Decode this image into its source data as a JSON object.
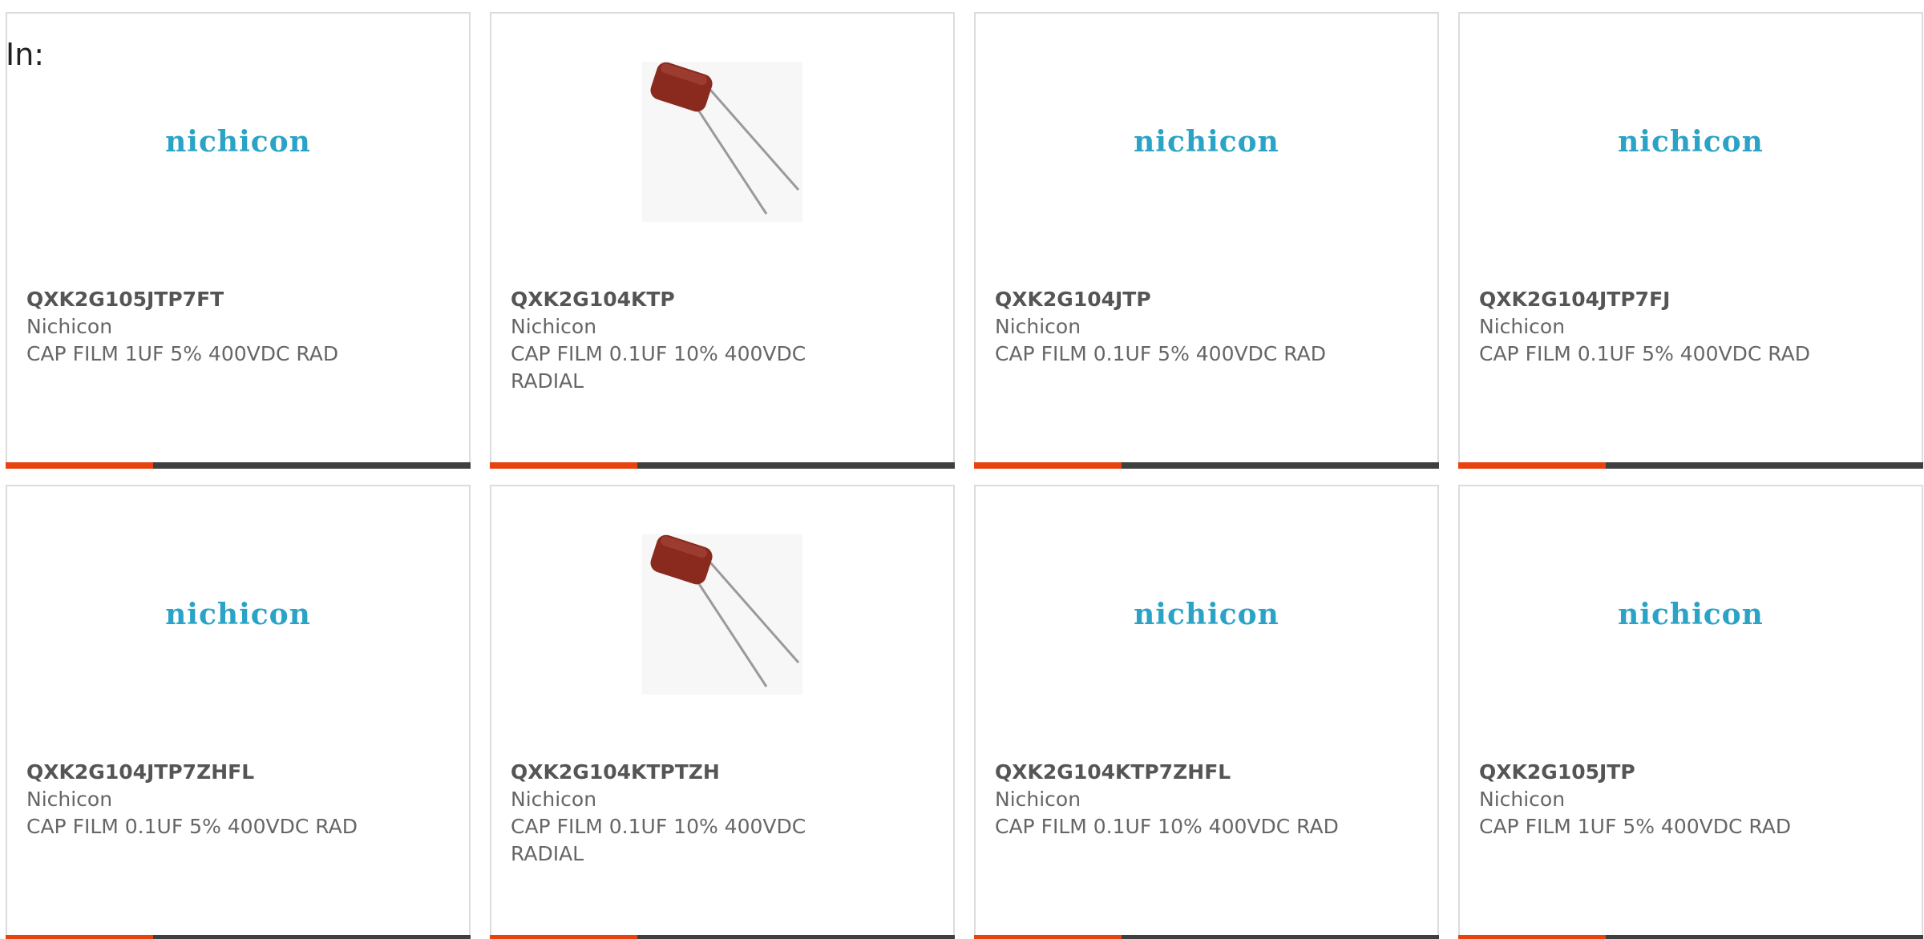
{
  "filter": {
    "in_label": "In:"
  },
  "products": [
    {
      "part": "QXK2G105JTP7FT",
      "maker": "Nichicon",
      "desc": "CAP FILM 1UF 5% 400VDC RAD",
      "image": "nichicon-logo",
      "logo_text": "nichicon"
    },
    {
      "part": "QXK2G104KTP",
      "maker": "Nichicon",
      "desc": "CAP FILM 0.1UF 10% 400VDC RADIAL",
      "image": "capacitor-photo",
      "logo_text": ""
    },
    {
      "part": "QXK2G104JTP",
      "maker": "Nichicon",
      "desc": "CAP FILM 0.1UF 5% 400VDC RAD",
      "image": "nichicon-logo",
      "logo_text": "nichicon"
    },
    {
      "part": "QXK2G104JTP7FJ",
      "maker": "Nichicon",
      "desc": "CAP FILM 0.1UF 5% 400VDC RAD",
      "image": "nichicon-logo",
      "logo_text": "nichicon"
    },
    {
      "part": "QXK2G104JTP7ZHFL",
      "maker": "Nichicon",
      "desc": "CAP FILM 0.1UF 5% 400VDC RAD",
      "image": "nichicon-logo",
      "logo_text": "nichicon"
    },
    {
      "part": "QXK2G104KTPTZH",
      "maker": "Nichicon",
      "desc": "CAP FILM 0.1UF 10% 400VDC RADIAL",
      "image": "capacitor-photo",
      "logo_text": ""
    },
    {
      "part": "QXK2G104KTP7ZHFL",
      "maker": "Nichicon",
      "desc": "CAP FILM 0.1UF 10% 400VDC RAD",
      "image": "nichicon-logo",
      "logo_text": "nichicon"
    },
    {
      "part": "QXK2G105JTP",
      "maker": "Nichicon",
      "desc": "CAP FILM 1UF 5% 400VDC RAD",
      "image": "nichicon-logo",
      "logo_text": "nichicon"
    }
  ],
  "colors": {
    "accent": "#e8420f",
    "bar": "#3f3f3f",
    "logo": "#2aa3c6",
    "text": "#666666"
  }
}
